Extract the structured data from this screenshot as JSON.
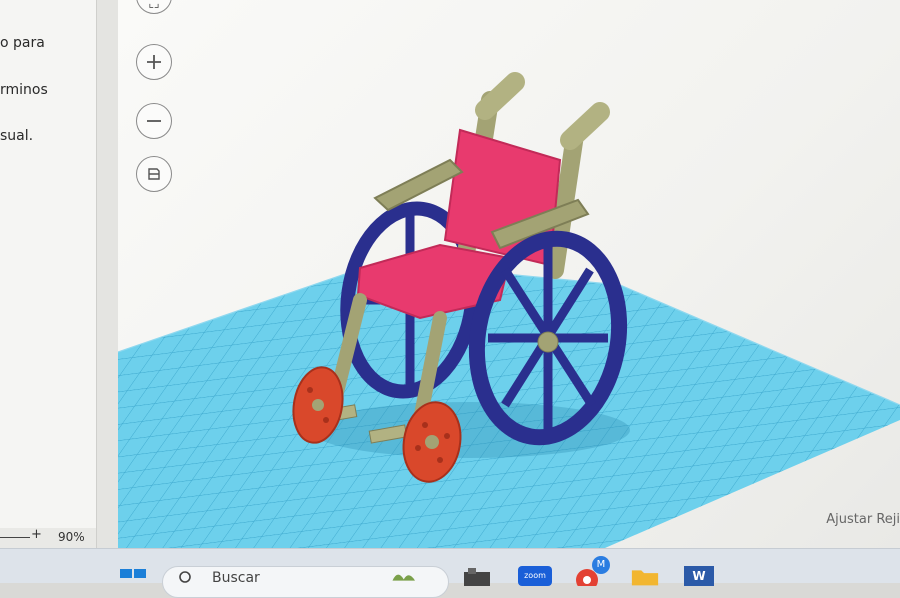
{
  "document": {
    "lines": [
      "o para",
      "rminos",
      "sual."
    ],
    "zoom_plus": "+",
    "zoom_level": "90%"
  },
  "view_controls": {
    "zoom_in_icon": "plus-icon",
    "zoom_out_icon": "minus-icon",
    "ortho_icon": "cube-icon"
  },
  "workplane": {
    "grid_label": "Ajustar Reji",
    "model": "wheelchair",
    "colors": {
      "seat": "#e83a6e",
      "frame": "#a3a374",
      "wheels": "#2a2f8e",
      "casters": "#d9482b",
      "grid": "#5ec8e8"
    }
  },
  "taskbar": {
    "search_placeholder": "Buscar",
    "zoom_label": "zoom",
    "profile_badge": "M",
    "word_label": "W"
  }
}
